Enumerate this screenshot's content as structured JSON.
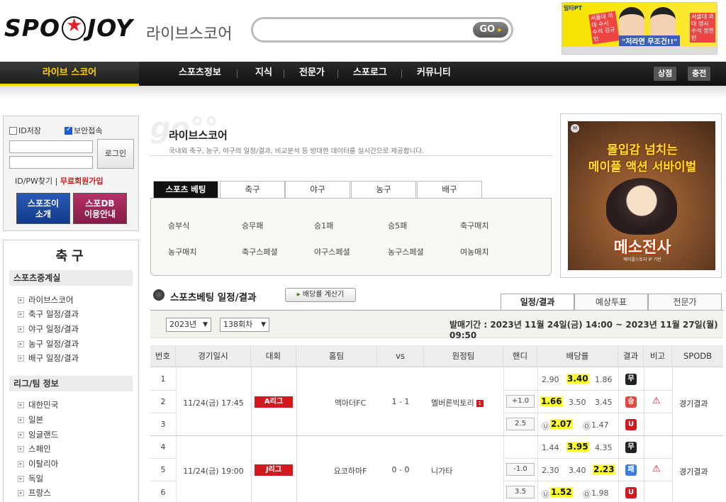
{
  "header": {
    "logo_left": "SPO",
    "logo_right": "JOY",
    "site_sub": "라이브스코어",
    "search_value": "",
    "go_label": "GO",
    "go_arrow": "▸",
    "top_ad": {
      "brand": "일타PT",
      "tag_left": "서울대 의대 수시 수석 김규민",
      "tag_right": "서울대 의대 정시 수석 정현빈",
      "slogan": "\"저라면 무조건!!\""
    }
  },
  "nav": {
    "live": "라이브 스코어",
    "items": [
      "스포츠정보",
      "지식",
      "전문가",
      "스포로그",
      "커뮤니티"
    ],
    "btn_shop": "상점",
    "btn_charge": "충전"
  },
  "login": {
    "save_id": "ID저장",
    "secure": "보안접속",
    "login_btn": "로그인",
    "find": "ID/PW찾기",
    "sep": "|",
    "join": "무료회원가입",
    "btn_intro": [
      "스포조이",
      "소개"
    ],
    "btn_db": [
      "스포DB",
      "이용안내"
    ]
  },
  "sidebar": {
    "title": "축구",
    "section1": "스포츠중계실",
    "items1": [
      "라이브스코어",
      "축구 일정/결과",
      "야구 일정/결과",
      "농구 일정/결과",
      "배구 일정/결과"
    ],
    "section2": "리그/팀 정보",
    "items2": [
      "대한민국",
      "일본",
      "잉글랜드",
      "스페인",
      "이탈리아",
      "독일",
      "프랑스"
    ]
  },
  "main": {
    "title": "라이브스코어",
    "desc": "국내외 축구, 농구, 야구의 일정/결과, 비교분석 등 방대한 데이터를 실시간으로 제공합니다.",
    "tabs": [
      "스포츠 베팅",
      "축구",
      "야구",
      "농구",
      "배구"
    ],
    "panel_row1": [
      "승부식",
      "승무패",
      "승1패",
      "승5패",
      "축구매치"
    ],
    "panel_row2": [
      "농구매치",
      "축구스페셜",
      "야구스페셜",
      "농구스페셜",
      "여농매치"
    ]
  },
  "right_ad": {
    "badge": "M",
    "line1": "몰입감 넘치는",
    "line2": "메이플 액션 서바이벌",
    "line3": "메소전사",
    "line4": "메이플스토리 IP 기반"
  },
  "schedule": {
    "title": "스포츠베팅 일정/결과",
    "calc_btn": "배당률 계산기",
    "right_tabs": [
      "일정/결과",
      "예상투표",
      "전문가"
    ],
    "year": "2023년",
    "round": "138회차",
    "period": "발매기간 : 2023년 11월 24일(금) 14:00 ~ 2023년 11월 27일(월) 09:50"
  },
  "table": {
    "headers": [
      "번호",
      "경기일시",
      "대회",
      "홈팀",
      "vs",
      "원정팀",
      "핸디",
      "배당률",
      "결과",
      "비고",
      "SPODB"
    ],
    "groups": [
      {
        "datetime": "11/24(금) 17:45",
        "league": "A리그",
        "home": "맥아더FC",
        "score": "1 - 1",
        "away": "멜버른빅토리",
        "away_badge": "1",
        "spodb": "경기결과",
        "rows": [
          {
            "no": "1",
            "handi": "",
            "odds": [
              "2.90",
              "3.40",
              "1.86"
            ],
            "hi": 1,
            "result": "무",
            "result_color": "#222"
          },
          {
            "no": "2",
            "handi": "+1.0",
            "odds": [
              "1.66",
              "3.50",
              "3.45"
            ],
            "hi": 0,
            "result": "승",
            "result_color": "#e0493f"
          },
          {
            "no": "3",
            "handi": "2.5",
            "odds": [
              "U",
              "2.07",
              "O",
              "1.47"
            ],
            "hi": 1,
            "result": "U",
            "result_color": "#d3181e"
          }
        ]
      },
      {
        "datetime": "11/24(금) 19:00",
        "league": "J리그",
        "home": "요코하마F",
        "score": "0 - 0",
        "away": "니가타",
        "away_badge": "",
        "spodb": "경기결과",
        "rows": [
          {
            "no": "4",
            "handi": "",
            "odds": [
              "1.44",
              "3.95",
              "4.35"
            ],
            "hi": 1,
            "result": "무",
            "result_color": "#222"
          },
          {
            "no": "5",
            "handi": "-1.0",
            "odds": [
              "2.30",
              "3.40",
              "2.23"
            ],
            "hi": 2,
            "result": "패",
            "result_color": "#3b7ddd"
          },
          {
            "no": "6",
            "handi": "3.5",
            "odds": [
              "U",
              "1.52",
              "O",
              "1.98"
            ],
            "hi": 1,
            "result": "U",
            "result_color": "#d3181e"
          }
        ]
      }
    ]
  }
}
